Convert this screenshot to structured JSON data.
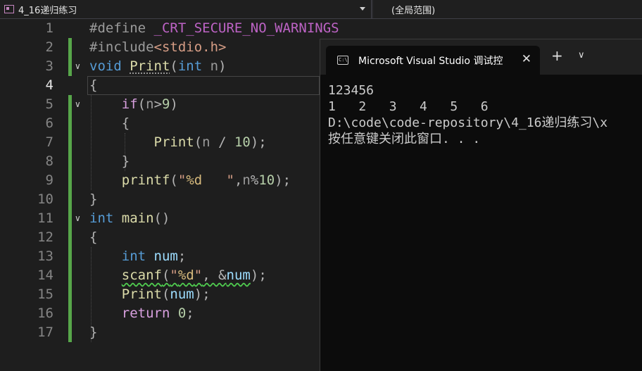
{
  "toolbar": {
    "project_dropdown": "4_16递归练习",
    "scope_dropdown": "(全局范围)"
  },
  "editor": {
    "line_numbers": [
      "1",
      "2",
      "3",
      "4",
      "5",
      "6",
      "7",
      "8",
      "9",
      "10",
      "11",
      "12",
      "13",
      "14",
      "15",
      "16",
      "17"
    ],
    "lines": [
      {
        "tokens": [
          [
            "#define ",
            "pp"
          ],
          [
            "_CRT_SECURE_NO_WARNINGS",
            "macro"
          ]
        ]
      },
      {
        "tokens": [
          [
            "#include",
            "pp"
          ],
          [
            "<stdio.h>",
            "inc"
          ]
        ]
      },
      {
        "tokens": [
          [
            "void ",
            "kw"
          ],
          [
            "Print",
            "fn"
          ],
          [
            "(",
            "punc"
          ],
          [
            "int ",
            "kw"
          ],
          [
            "n",
            "param"
          ],
          [
            ")",
            "punc"
          ]
        ]
      },
      {
        "tokens": [
          [
            "{",
            "punc"
          ]
        ]
      },
      {
        "tokens": [
          [
            "    ",
            "punc"
          ],
          [
            "if",
            "ctrl"
          ],
          [
            "(",
            "punc"
          ],
          [
            "n",
            "param"
          ],
          [
            ">",
            "punc"
          ],
          [
            "9",
            "num"
          ],
          [
            ")",
            "punc"
          ]
        ]
      },
      {
        "tokens": [
          [
            "    {",
            "punc"
          ]
        ]
      },
      {
        "tokens": [
          [
            "        ",
            "punc"
          ],
          [
            "Print",
            "fn"
          ],
          [
            "(",
            "punc"
          ],
          [
            "n",
            "param"
          ],
          [
            " / ",
            "punc"
          ],
          [
            "10",
            "num"
          ],
          [
            ");",
            "punc"
          ]
        ]
      },
      {
        "tokens": [
          [
            "    }",
            "punc"
          ]
        ]
      },
      {
        "tokens": [
          [
            "    ",
            "punc"
          ],
          [
            "printf",
            "fn"
          ],
          [
            "(",
            "punc"
          ],
          [
            "\"",
            "str"
          ],
          [
            "%d",
            "fmt"
          ],
          [
            "   \"",
            "str"
          ],
          [
            ",",
            "punc"
          ],
          [
            "n",
            "param"
          ],
          [
            "%",
            "punc"
          ],
          [
            "10",
            "num"
          ],
          [
            ");",
            "punc"
          ]
        ]
      },
      {
        "tokens": [
          [
            "}",
            "punc"
          ]
        ]
      },
      {
        "tokens": [
          [
            "int ",
            "kw"
          ],
          [
            "main",
            "fn"
          ],
          [
            "()",
            "punc"
          ]
        ]
      },
      {
        "tokens": [
          [
            "{",
            "punc"
          ]
        ]
      },
      {
        "tokens": [
          [
            "    ",
            "punc"
          ],
          [
            "int ",
            "kw"
          ],
          [
            "num",
            "var"
          ],
          [
            ";",
            "punc"
          ]
        ]
      },
      {
        "tokens": [
          [
            "    ",
            "punc"
          ],
          [
            "scanf",
            "fn"
          ],
          [
            "(",
            "punc"
          ],
          [
            "\"",
            "str"
          ],
          [
            "%d",
            "fmt"
          ],
          [
            "\"",
            "str"
          ],
          [
            ", &",
            "punc"
          ],
          [
            "num",
            "var"
          ],
          [
            ");",
            "punc"
          ]
        ]
      },
      {
        "tokens": [
          [
            "    ",
            "punc"
          ],
          [
            "Print",
            "fn"
          ],
          [
            "(",
            "punc"
          ],
          [
            "num",
            "var"
          ],
          [
            ");",
            "punc"
          ]
        ]
      },
      {
        "tokens": [
          [
            "    ",
            "punc"
          ],
          [
            "return ",
            "ctrl"
          ],
          [
            "0",
            "num"
          ],
          [
            ";",
            "punc"
          ]
        ]
      },
      {
        "tokens": [
          [
            "}",
            "punc"
          ]
        ]
      }
    ]
  },
  "console": {
    "title": "Microsoft Visual Studio 调试控",
    "output_lines": [
      "123456",
      "1   2   3   4   5   6",
      "D:\\code\\code-repository\\4_16递归练习\\x",
      "按任意键关闭此窗口. . ."
    ]
  },
  "colors": {
    "editor_bg": "#1e1e1e",
    "console_bg": "#0c0c0c",
    "change_bar": "#57a64a",
    "keyword": "#569cd6",
    "function": "#dcdcaa"
  },
  "icons": {
    "project": "project-icon",
    "console": "console-app-icon",
    "close": "close-icon",
    "new_tab": "plus-icon",
    "dropdown": "chevron-down-icon"
  }
}
